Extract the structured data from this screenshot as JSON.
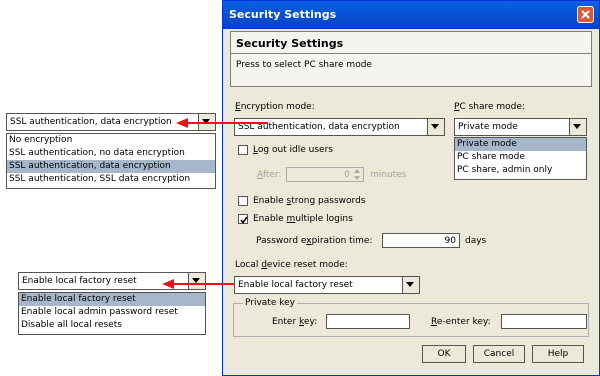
{
  "window": {
    "title": "Security Settings",
    "header_title": "Security Settings",
    "header_desc": "Press to select PC share mode"
  },
  "encryption": {
    "label_pre": "",
    "label_u": "E",
    "label_post": "ncryption mode:",
    "value": "SSL authentication, data encryption"
  },
  "share": {
    "label_u": "P",
    "label_post": "C share mode:",
    "value": "Private mode",
    "options": [
      "Private mode",
      "PC share mode",
      "PC share, admin only"
    ],
    "selected_index": 0
  },
  "idle": {
    "label_u": "L",
    "label_post": "og out idle users",
    "checked": false,
    "after_u": "A",
    "after_post": "fter:",
    "value": "0",
    "unit": "minutes"
  },
  "strong_pw": {
    "label_pre": "Enable ",
    "label_u": "s",
    "label_post": "trong passwords",
    "checked": false
  },
  "multi_login": {
    "label_pre": "Enable ",
    "label_u": "m",
    "label_post": "ultiple logins",
    "checked": true
  },
  "pw_exp": {
    "label_pre": "Password e",
    "label_u": "x",
    "label_post": "piration time:",
    "value": "90",
    "unit": "days"
  },
  "reset": {
    "label_pre": "Local ",
    "label_u": "d",
    "label_post": "evice reset mode:",
    "value": "Enable local factory reset"
  },
  "private_key": {
    "group_label": "Private key",
    "enter_pre": "Enter ",
    "enter_u": "k",
    "enter_post": "ey:",
    "reenter_u": "R",
    "reenter_post": "e-enter key:",
    "enter_value": "",
    "reenter_value": ""
  },
  "buttons": {
    "ok": "OK",
    "cancel": "Cancel",
    "help": "Help"
  },
  "callout_encryption": {
    "value": "SSL authentication, data encryption",
    "options": [
      "No encryption",
      "SSL authentication, no data encryption",
      "SSL authentication, data encryption",
      "SSL authentication, SSL data encryption"
    ],
    "selected_index": 2
  },
  "callout_reset": {
    "value": "Enable local factory reset",
    "options": [
      "Enable local factory reset",
      "Enable local admin password reset",
      "Disable all local resets"
    ],
    "selected_index": 0
  },
  "colors": {
    "titlebar": "#0654D8",
    "dialog_bg": "#ECE9D8",
    "selection": "#A6B7CC",
    "arrow": "#E8141A"
  }
}
